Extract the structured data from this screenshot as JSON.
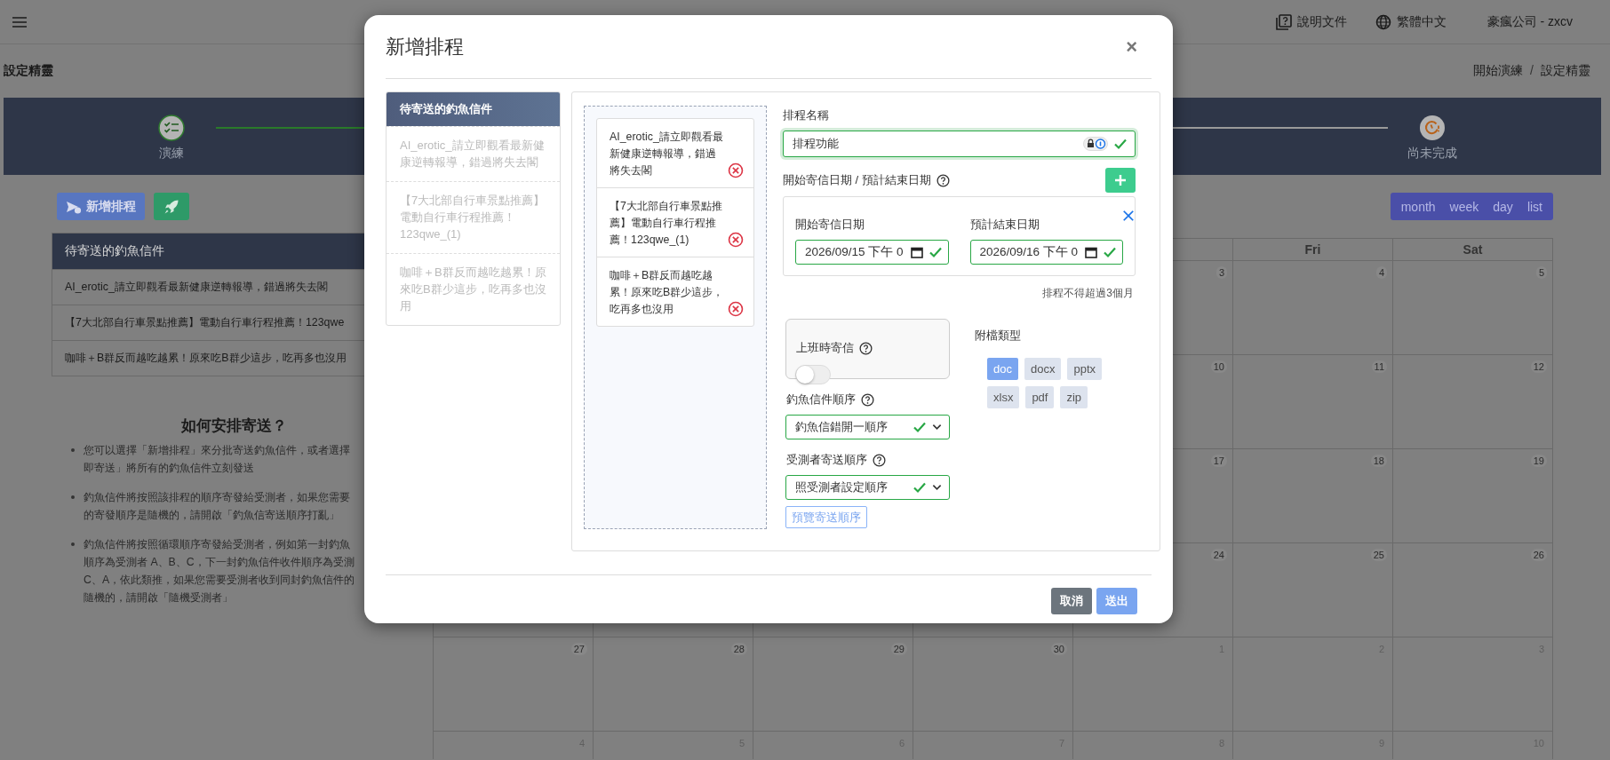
{
  "topbar": {
    "links": [
      {
        "kind": "docs",
        "label": "說明文件"
      },
      {
        "kind": "language",
        "label": "繁體中文"
      }
    ],
    "account": "豪瘋公司 - zxcv"
  },
  "page_header": {
    "title": "設定精靈",
    "breadcrumb": [
      "開始演練",
      "設定精靈"
    ],
    "breadcrumb_separator": "/"
  },
  "steps": [
    {
      "label": "演練",
      "completed": true
    },
    {
      "label": "尚未完成",
      "completed": false
    }
  ],
  "actions": {
    "new_schedule": "新增排程"
  },
  "pending_mail": {
    "title": "待寄送的釣魚信件",
    "items": [
      "AI_erotic_請立即觀看最新健康逆轉報導，錯過將失去閣",
      "【7大北部自行車景點推薦】電動自行車行程推薦！123qwe",
      "咖啡＋B群反而越吃越累！原來吃B群少這步，吃再多也沒用"
    ]
  },
  "guide": {
    "title": "如何安排寄送？",
    "bullets": [
      {
        "lines": [
          "您可以選擇「新增排程」來分批寄送釣魚信件，或者選擇",
          "即寄送」將所有的釣魚信件立刻發送"
        ]
      },
      {
        "lines": [
          "釣魚信件將按照該排程的順序寄發給受測者，如果您需要",
          "的寄發順序是隨機的，請開啟「釣魚信寄送順序打亂」"
        ]
      },
      {
        "lines": [
          "釣魚信件將按照循環順序寄發給受測者，例如第一封釣魚",
          "順序為受測者 A、B、C，下一封釣魚信件收件順序為受測",
          "C、A，依此類推，如果您需要受測者收到同封釣魚信件的",
          "隨機的，請開啟「隨機受測者」"
        ]
      }
    ]
  },
  "calendar": {
    "views": [
      "month",
      "week",
      "day",
      "list"
    ],
    "header_labels": [
      "Fri",
      "Sat"
    ],
    "weeks": [
      {
        "days": [
          {
            "day": "3",
            "other_month": false
          },
          {
            "day": "4",
            "other_month": false
          },
          {
            "day": "5",
            "other_month": false
          }
        ]
      },
      {
        "days": [
          {
            "day": "10",
            "other_month": false
          },
          {
            "day": "11",
            "other_month": false
          },
          {
            "day": "12",
            "other_month": false
          }
        ]
      },
      {
        "days": [
          {
            "day": "17",
            "other_month": false
          },
          {
            "day": "18",
            "other_month": false
          },
          {
            "day": "19",
            "other_month": false
          }
        ]
      },
      {
        "days": [
          {
            "day": "24",
            "other_month": false
          },
          {
            "day": "25",
            "other_month": false
          },
          {
            "day": "26",
            "other_month": false
          }
        ]
      },
      {
        "days": [
          {
            "day": "27",
            "other_month": false
          },
          {
            "day": "28",
            "other_month": false
          },
          {
            "day": "29",
            "other_month": false
          },
          {
            "day": "30",
            "other_month": false
          },
          {
            "day": "1",
            "other_month": true
          },
          {
            "day": "2",
            "other_month": true
          },
          {
            "day": "3",
            "other_month": true
          }
        ]
      },
      {
        "days": [
          {
            "day": "4",
            "other_month": true
          },
          {
            "day": "5",
            "other_month": true
          },
          {
            "day": "6",
            "other_month": true
          },
          {
            "day": "7",
            "other_month": true
          },
          {
            "day": "8",
            "other_month": true
          },
          {
            "day": "9",
            "other_month": true
          },
          {
            "day": "10",
            "other_month": true
          }
        ]
      }
    ]
  },
  "modal": {
    "title": "新增排程",
    "close": "×",
    "source_list": {
      "title": "待寄送的釣魚信件",
      "items": [
        "AI_erotic_請立即觀看最新健康逆轉報導，錯過將失去閣",
        "【7大北部自行車景點推薦】電動自行車行程推薦！123qwe_(1)",
        "咖啡＋B群反而越吃越累！原來吃B群少這步，吃再多也沒用"
      ]
    },
    "selected_items": [
      "AI_erotic_請立即觀看最新健康逆轉報導，錯過將失去閣",
      "【7大北部自行車景點推薦】電動自行車行程推薦！123qwe_(1)",
      "咖啡＋B群反而越吃越累！原來吃B群少這步，吃再多也沒用"
    ],
    "form": {
      "name_field": {
        "label": "排程名稱",
        "value": "排程功能",
        "valid": true
      },
      "dates": {
        "label": "開始寄信日期 / 預計結束日期",
        "ranges": [
          {
            "start_label": "開始寄信日期",
            "start_value": "2026/09/15 下午 0",
            "end_label": "預計結束日期",
            "end_value": "2026/09/16 下午 0",
            "valid": true
          }
        ],
        "note": "排程不得超過3個月"
      },
      "office_hours": {
        "label": "上班時寄信",
        "on": false
      },
      "mail_order": {
        "label": "釣魚信件順序",
        "value": "釣魚信錯開一順序",
        "valid": true
      },
      "recipient_order": {
        "label": "受測者寄送順序",
        "value": "照受測者設定順序",
        "valid": true
      },
      "preview_button": "預覽寄送順序",
      "attachments": {
        "label": "附檔類型",
        "types": [
          {
            "label": "doc",
            "selected": true
          },
          {
            "label": "docx",
            "selected": false
          },
          {
            "label": "pptx",
            "selected": false
          },
          {
            "label": "xlsx",
            "selected": false
          },
          {
            "label": "pdf",
            "selected": false
          },
          {
            "label": "zip",
            "selected": false
          }
        ]
      }
    },
    "footer": {
      "cancel": "取消",
      "submit": "送出"
    }
  }
}
